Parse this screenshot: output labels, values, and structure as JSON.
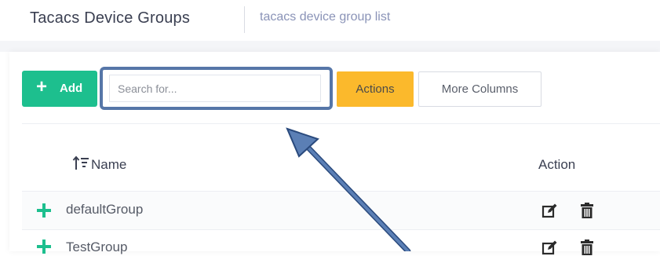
{
  "header": {
    "title": "Tacacs Device Groups",
    "subtitle": "tacacs device group list"
  },
  "toolbar": {
    "add_label": "Add",
    "search_placeholder": "Search for...",
    "actions_label": "Actions",
    "more_columns_label": "More Columns"
  },
  "table": {
    "columns": [
      "Name",
      "Action"
    ],
    "rows": [
      {
        "name": "defaultGroup"
      },
      {
        "name": "TestGroup"
      }
    ]
  },
  "colors": {
    "add_button": "#1dbf8e",
    "actions_button": "#fbb92c",
    "highlight_box": "#5676a8"
  },
  "icons": [
    "plus-icon",
    "sort-icon",
    "expand-icon",
    "edit-icon",
    "trash-icon",
    "annotation-arrow"
  ]
}
